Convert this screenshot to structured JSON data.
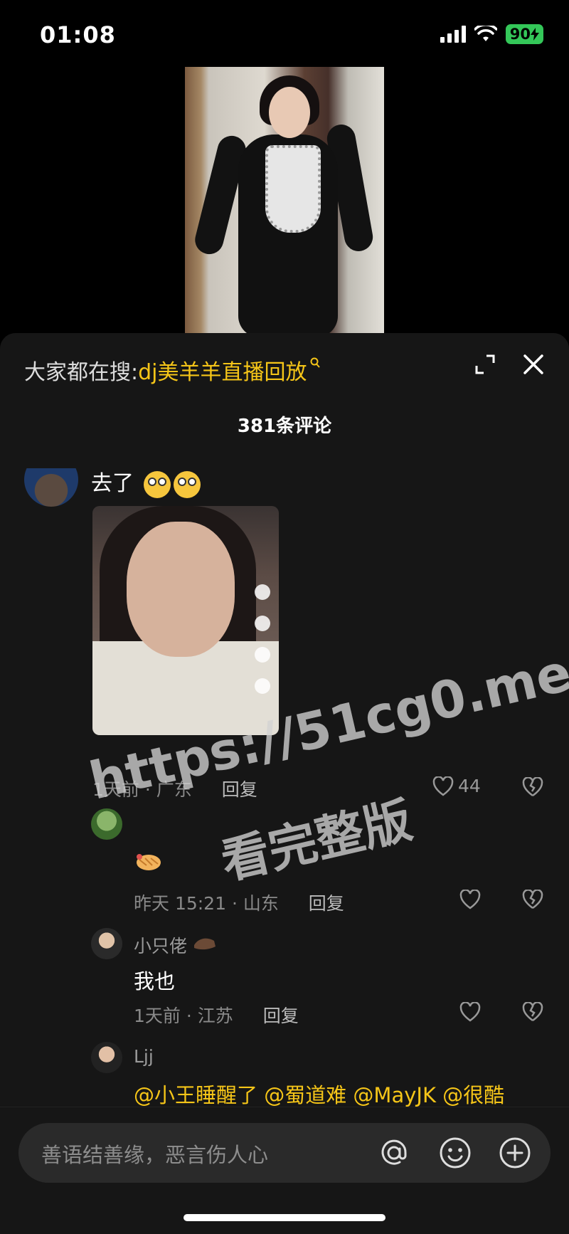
{
  "status": {
    "time": "01:08",
    "battery": "90"
  },
  "sheet": {
    "search_prefix": "大家都在搜:",
    "search_term": "dj美羊羊直播回放",
    "comment_count": "381条评论"
  },
  "comments": [
    {
      "text": "去了",
      "time_loc": "1天前 · 广东",
      "reply": "回复",
      "likes": "44"
    },
    {
      "username": "",
      "time_loc": "昨天 15:21 · 山东",
      "reply": "回复"
    },
    {
      "username": "小只佬",
      "text": "我也",
      "time_loc": "1天前 · 江苏",
      "reply": "回复"
    },
    {
      "username": "Ljj",
      "text": "@小王睡醒了 @蜀道难 @MayJK @很酷"
    }
  ],
  "watermark": {
    "line1": "https://51cg0.me",
    "line2": "看完整版"
  },
  "composer": {
    "placeholder": "善语结善缘，恶言伤人心"
  },
  "icons": [
    "expand-icon",
    "close-icon",
    "heart-icon",
    "broken-heart-icon",
    "at-icon",
    "emoji-icon",
    "plus-icon"
  ],
  "colors": {
    "accent": "#f5c518",
    "battery": "#34c759",
    "sheet_bg": "#161616"
  }
}
